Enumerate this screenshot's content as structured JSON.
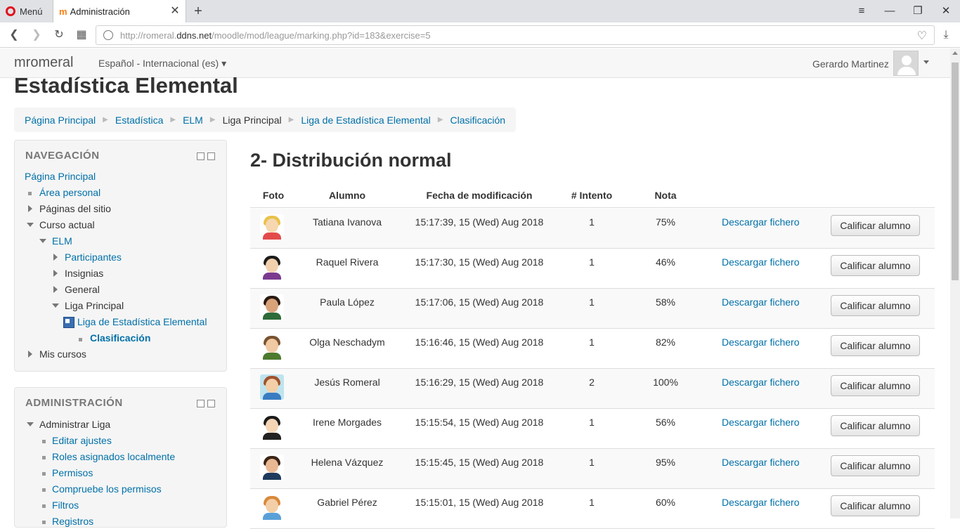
{
  "browser": {
    "menu_label": "Menú",
    "tab_title": "Administración",
    "url_prefix": "http://romeral.",
    "url_host": "ddns.net",
    "url_path": "/moodle/mod/league/marking.php?id=183&exercise=5"
  },
  "header": {
    "site_name": "mromeral",
    "language": "Español - Internacional (es) ▾",
    "user_name": "Gerardo Martinez"
  },
  "page": {
    "title": "Estadística Elemental",
    "breadcrumb": [
      "Página Principal",
      "Estadística",
      "ELM",
      "Liga Principal",
      "Liga de Estadística Elemental",
      "Clasificación"
    ]
  },
  "navigation": {
    "title": "NAVEGACIÓN",
    "items": [
      "Página Principal",
      "Área personal",
      "Páginas del sitio",
      "Curso actual",
      "ELM",
      "Participantes",
      "Insignias",
      "General",
      "Liga Principal",
      "Liga de Estadística Elemental",
      "Clasificación",
      "Mis cursos"
    ]
  },
  "administration": {
    "title": "ADMINISTRACIÓN",
    "items": [
      "Administrar Liga",
      "Editar ajustes",
      "Roles asignados localmente",
      "Permisos",
      "Compruebe los permisos",
      "Filtros",
      "Registros"
    ]
  },
  "main": {
    "heading": "2- Distribución normal",
    "columns": [
      "Foto",
      "Alumno",
      "Fecha de modificación",
      "# Intento",
      "Nota"
    ],
    "download_label": "Descargar fichero",
    "grade_label": "Calificar alumno",
    "rows": [
      {
        "name": "Tatiana Ivanova",
        "date": "15:17:39, 15 (Wed) Aug 2018",
        "attempt": "1",
        "grade": "75%"
      },
      {
        "name": "Raquel Rivera",
        "date": "15:17:30, 15 (Wed) Aug 2018",
        "attempt": "1",
        "grade": "46%"
      },
      {
        "name": "Paula López",
        "date": "15:17:06, 15 (Wed) Aug 2018",
        "attempt": "1",
        "grade": "58%"
      },
      {
        "name": "Olga Neschadym",
        "date": "15:16:46, 15 (Wed) Aug 2018",
        "attempt": "1",
        "grade": "82%"
      },
      {
        "name": "Jesús Romeral",
        "date": "15:16:29, 15 (Wed) Aug 2018",
        "attempt": "2",
        "grade": "100%"
      },
      {
        "name": "Irene Morgades",
        "date": "15:15:54, 15 (Wed) Aug 2018",
        "attempt": "1",
        "grade": "56%"
      },
      {
        "name": "Helena Vázquez",
        "date": "15:15:45, 15 (Wed) Aug 2018",
        "attempt": "1",
        "grade": "95%"
      },
      {
        "name": "Gabriel Pérez",
        "date": "15:15:01, 15 (Wed) Aug 2018",
        "attempt": "1",
        "grade": "60%"
      }
    ]
  }
}
